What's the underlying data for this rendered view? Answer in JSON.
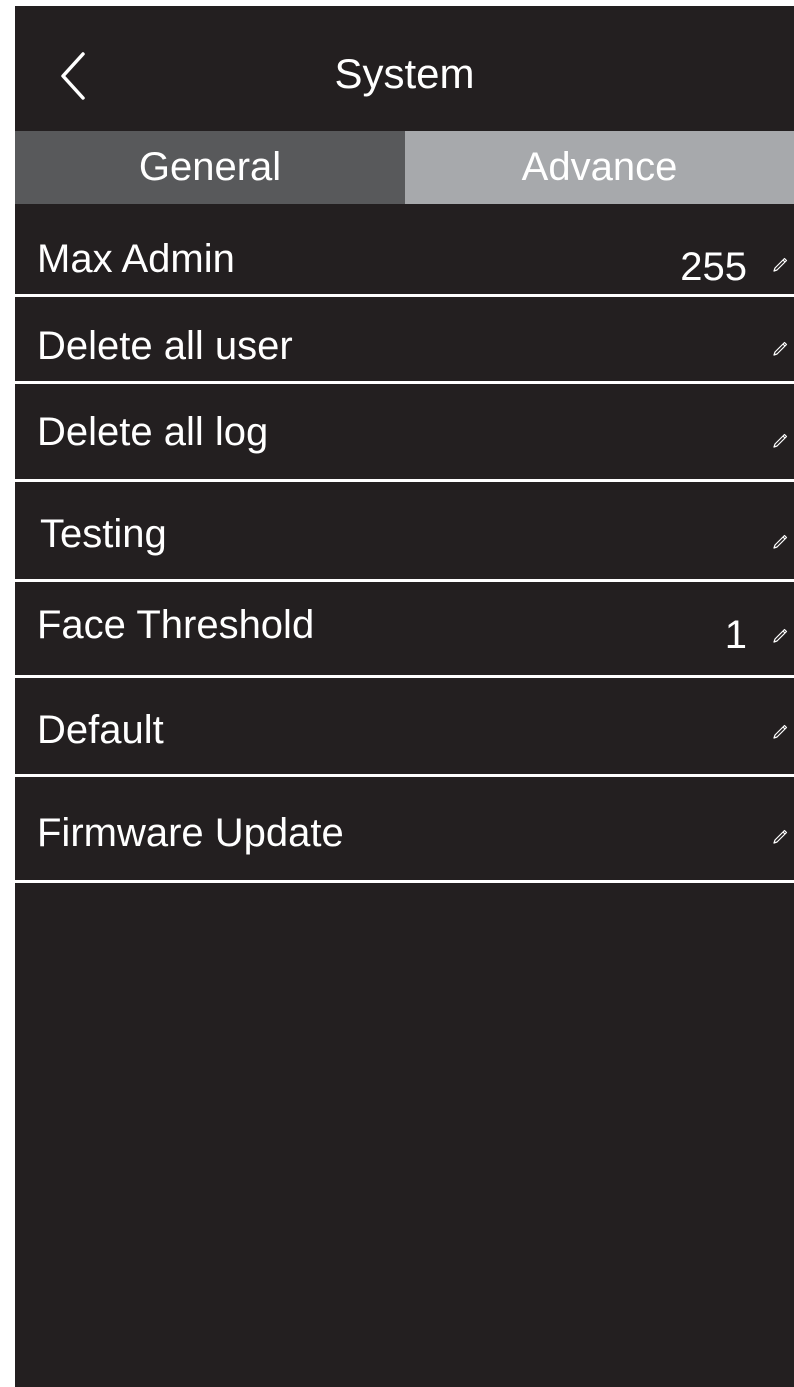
{
  "header": {
    "title": "System",
    "back_icon": "chevron-left-icon"
  },
  "tabs": [
    {
      "label": "General",
      "active": false
    },
    {
      "label": "Advance",
      "active": true
    }
  ],
  "settings": [
    {
      "label": "Max Admin",
      "value": "255",
      "icon": "pencil-icon"
    },
    {
      "label": "Delete all user",
      "value": "",
      "icon": "pencil-icon"
    },
    {
      "label": "Delete all log",
      "value": "",
      "icon": "pencil-icon"
    },
    {
      "label": "Testing",
      "value": "",
      "icon": "pencil-icon"
    },
    {
      "label": "Face Threshold",
      "value": "1",
      "icon": "pencil-icon"
    },
    {
      "label": "Default",
      "value": "",
      "icon": "pencil-icon"
    },
    {
      "label": "Firmware Update",
      "value": "",
      "icon": "pencil-icon"
    }
  ],
  "colors": {
    "background": "#231f20",
    "tab_inactive": "#58595b",
    "tab_active": "#a7a9ac",
    "text": "#ffffff",
    "divider": "#ffffff"
  }
}
